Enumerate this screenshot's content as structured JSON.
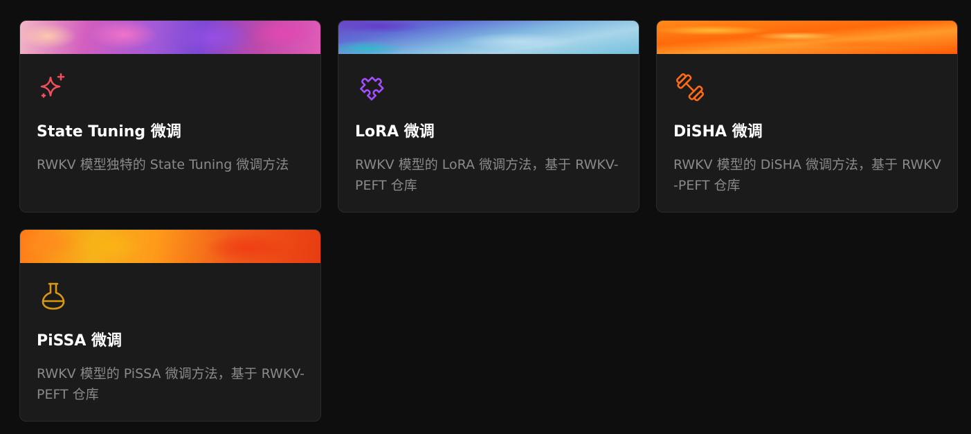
{
  "cards": [
    {
      "title": "State Tuning 微调",
      "description": "RWKV 模型独特的 State Tuning 微调方法",
      "icon": "sparkles-icon",
      "icon_color": "#f0505a",
      "banner_colors": [
        "#f3b6c4",
        "#d35fc0",
        "#a25ad8",
        "#7b48d4"
      ]
    },
    {
      "title": "LoRA 微调",
      "description": "RWKV 模型的 LoRA 微调方法，基于 RWKV-PEFT 仓库",
      "icon": "puzzle-icon",
      "icon_color": "#a64dff",
      "banner_colors": [
        "#6b43c6",
        "#7fb7e0",
        "#a9d5ea",
        "#40c0c8"
      ]
    },
    {
      "title": "DiSHA 微调",
      "description": "RWKV 模型的 DiSHA 微调方法，基于 RWKV-PEFT 仓库",
      "icon": "dumbbell-icon",
      "icon_color": "#ff6a14",
      "banner_colors": [
        "#ff8a1a",
        "#ff6a0a",
        "#ffc83c",
        "#ff5a05"
      ]
    },
    {
      "title": "PiSSA 微调",
      "description": "RWKV 模型的 PiSSA 微调方法，基于 RWKV-PEFT 仓库",
      "icon": "flask-icon",
      "icon_color": "#d99a12",
      "banner_colors": [
        "#ff7a1a",
        "#f6b21a",
        "#f05a1a",
        "#e83c12"
      ]
    }
  ]
}
